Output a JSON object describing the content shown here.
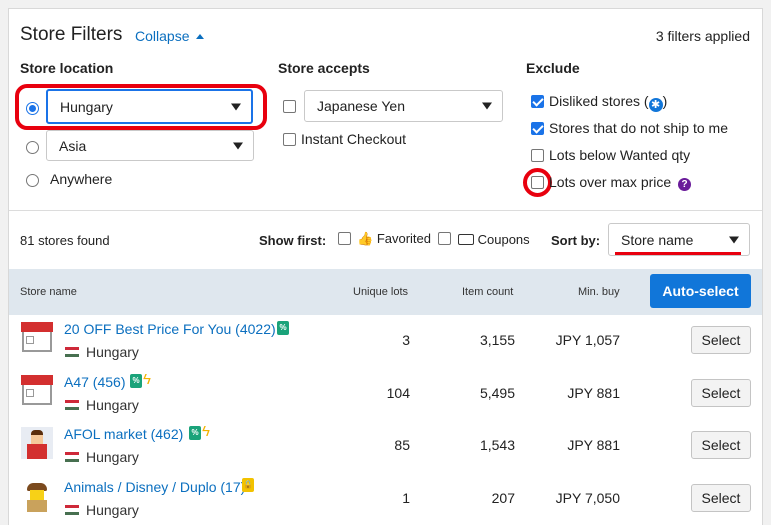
{
  "header": {
    "title": "Store Filters",
    "collapse_label": "Collapse",
    "filters_applied": "3 filters applied"
  },
  "location": {
    "heading": "Store location",
    "country_value": "Hungary",
    "region_value": "Asia",
    "anywhere_label": "Anywhere"
  },
  "accepts": {
    "heading": "Store accepts",
    "currency_value": "Japanese Yen",
    "instant_checkout_label": "Instant Checkout"
  },
  "exclude": {
    "heading": "Exclude",
    "items": [
      {
        "label": "Disliked stores (",
        "suffix": ")",
        "checked": true
      },
      {
        "label": "Stores that do not ship to me",
        "checked": true
      },
      {
        "label": "Lots below Wanted qty",
        "checked": false
      },
      {
        "label": "Lots over max price",
        "checked": false
      }
    ]
  },
  "toolbar": {
    "stores_found": "81 stores found",
    "show_first_label": "Show first:",
    "favorited_label": "Favorited",
    "coupons_label": "Coupons",
    "sort_by_label": "Sort by:",
    "sort_value": "Store name"
  },
  "table": {
    "columns": [
      "Store name",
      "Unique lots",
      "Item count",
      "Min. buy"
    ],
    "autoselect_label": "Auto-select",
    "select_label": "Select",
    "rows": [
      {
        "name": "20 OFF Best Price For You (4022)",
        "country": "Hungary",
        "unique_lots": "3",
        "item_count": "3,155",
        "min_buy": "JPY 1,057",
        "avatar": "storefront-icon"
      },
      {
        "name": "A47 (456)",
        "country": "Hungary",
        "unique_lots": "104",
        "item_count": "5,495",
        "min_buy": "JPY 881",
        "avatar": "storefront-icon"
      },
      {
        "name": "AFOL market (462)",
        "country": "Hungary",
        "unique_lots": "85",
        "item_count": "1,543",
        "min_buy": "JPY 881",
        "avatar": "minifig-avatar"
      },
      {
        "name": "Animals / Disney / Duplo (17)",
        "country": "Hungary",
        "unique_lots": "1",
        "item_count": "207",
        "min_buy": "JPY 7,050",
        "avatar": "minifig-avatar"
      }
    ]
  },
  "colors": {
    "accent": "#1176d9",
    "link": "#0b6fbf",
    "highlight": "#e8000e"
  }
}
